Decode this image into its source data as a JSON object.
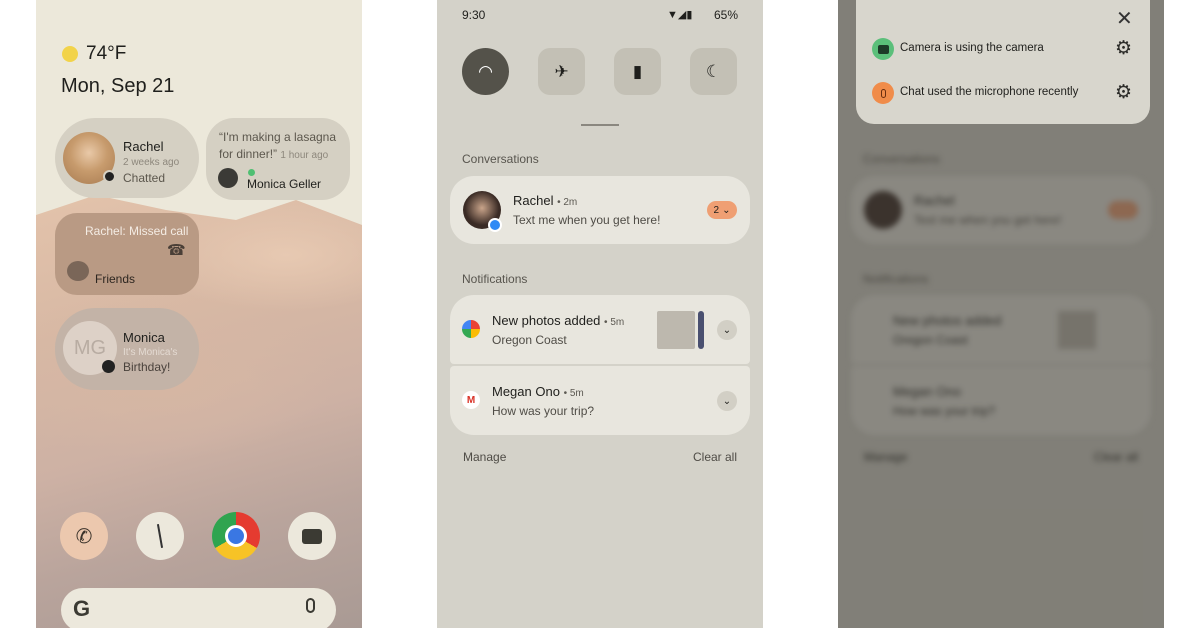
{
  "home": {
    "weather": {
      "temp": "74°F",
      "icon": "partly-sunny-icon"
    },
    "date": "Mon, Sep 21",
    "widgets": [
      {
        "name": "Rachel",
        "time": "2 weeks ago",
        "status": "Chatted"
      },
      {
        "quote": "“I'm making a lasagna for dinner!”",
        "time": "1 hour ago",
        "name": "Monica Geller"
      },
      {
        "title": "Rachel: Missed call",
        "group": "Friends"
      },
      {
        "initials": "MG",
        "name": "Monica",
        "time": "It's Monica's",
        "status": "Birthday!"
      }
    ],
    "dock": [
      "phone-icon",
      "clock-icon",
      "chrome-icon",
      "camera-icon"
    ],
    "search": {
      "logo": "G",
      "icon": "microphone-icon"
    }
  },
  "shade": {
    "status": {
      "time": "9:30",
      "battery": "65%"
    },
    "tiles": [
      "wifi-icon",
      "airplane-icon",
      "battery-saver-icon",
      "dnd-moon-icon"
    ],
    "conversations_label": "Conversations",
    "conversation": {
      "name": "Rachel",
      "time": "2m",
      "message": "Text me when you get here!",
      "count": "2"
    },
    "notifications_label": "Notifications",
    "notifications": [
      {
        "title": "New photos added",
        "time": "5m",
        "text": "Oregon Coast"
      },
      {
        "title": "Megan Ono",
        "time": "5m",
        "text": "How was your trip?"
      }
    ],
    "manage": "Manage",
    "clear_all": "Clear all"
  },
  "privacy": {
    "items": [
      {
        "text": "Camera is using the camera",
        "color": "#5bbf7a"
      },
      {
        "text": "Chat used the microphone recently",
        "color": "#f08c4a"
      }
    ]
  }
}
